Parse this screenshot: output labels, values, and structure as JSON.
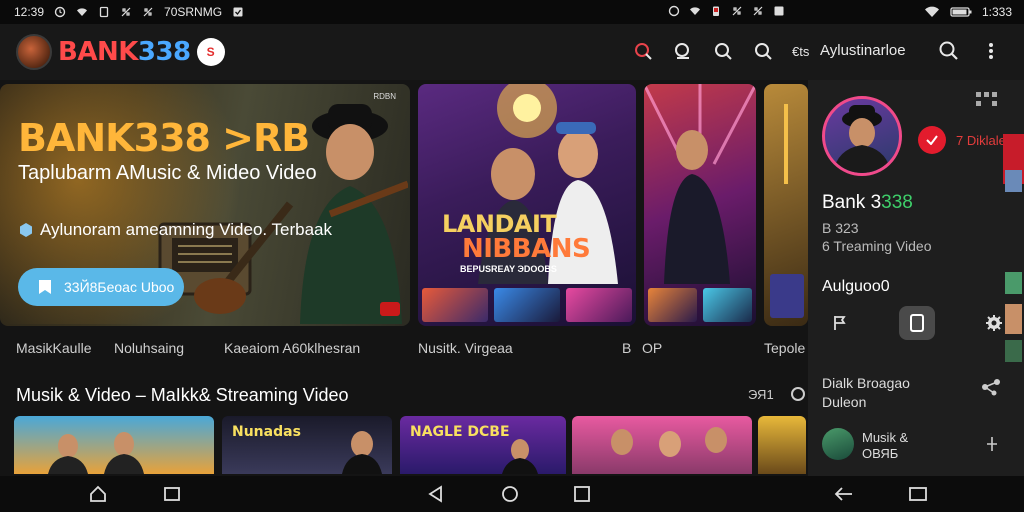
{
  "status_bar": {
    "left_time": "12:39",
    "left_label": "70SRNMG",
    "right_battery": "1:333"
  },
  "header": {
    "logo_text_red": "BANK",
    "logo_text_blue": "338",
    "logo_badge": "S",
    "user_name": "Aylustinarloe"
  },
  "hero": {
    "brand": "BANK338 >RB",
    "subtitle": "Taplubarm AMusic & Mideo   Video",
    "line": "Aylunoram ameamning Video. Terbaak",
    "button_label": "33Й8Бeoac Uboo",
    "tag": "RDBN"
  },
  "featured": {
    "title1": "LANDAIT",
    "title2": "NIBBANS",
    "title3": "BEPUSREAY ЭDOOBS"
  },
  "labels": {
    "hero_row": [
      "MasikKaulle",
      "Noluhsaing",
      "Kaeaiom A60klhesran"
    ],
    "featured": "Nusitk. Virgeaa",
    "third": "B",
    "third_ico": "OP",
    "fourth": "Tepole"
  },
  "section": {
    "title": "Musik & Video  –  MaIkk& Streaming Video",
    "ctrl_label": "ЭЯ1"
  },
  "thumbs": [
    {
      "label": "",
      "colors": [
        "#4aa8d8",
        "#e8a23a"
      ]
    },
    {
      "label": "Nunadas",
      "colors": [
        "#1a1a2a",
        "#3a3a5a"
      ]
    },
    {
      "label": "NAGLE DCBE",
      "colors": [
        "#6a2aa0",
        "#2a1a6a"
      ]
    },
    {
      "label": "",
      "colors": [
        "#e85aa0",
        "#8a3a6a"
      ]
    },
    {
      "label": "",
      "colors": [
        "#e8b83a",
        "#6a4a1a"
      ]
    }
  ],
  "side_panel": {
    "subscribe_label": "7 Diklale",
    "name_prefix": "Bank 3",
    "name_green": "338",
    "count": "В 323",
    "desc": "6 Treaming Video",
    "section_label": "Aulguoo0",
    "item1_line1": "Dialk Broagao",
    "item1_line2": "Duleon",
    "item2_line1": "Musik &",
    "item2_line2": "ОВЯБ"
  },
  "colors": {
    "accent_red": "#e31c2d",
    "accent_blue": "#4aa8ff",
    "accent_gold": "#ffb63a",
    "button_blue": "#5ab8e8"
  },
  "icons": [
    "wifi-icon",
    "signal-icon",
    "battery-icon",
    "search-icon",
    "kebab-icon",
    "grid-icon",
    "flag-icon",
    "bookmark-icon",
    "gear-icon",
    "back-icon",
    "home-icon",
    "recents-icon"
  ]
}
